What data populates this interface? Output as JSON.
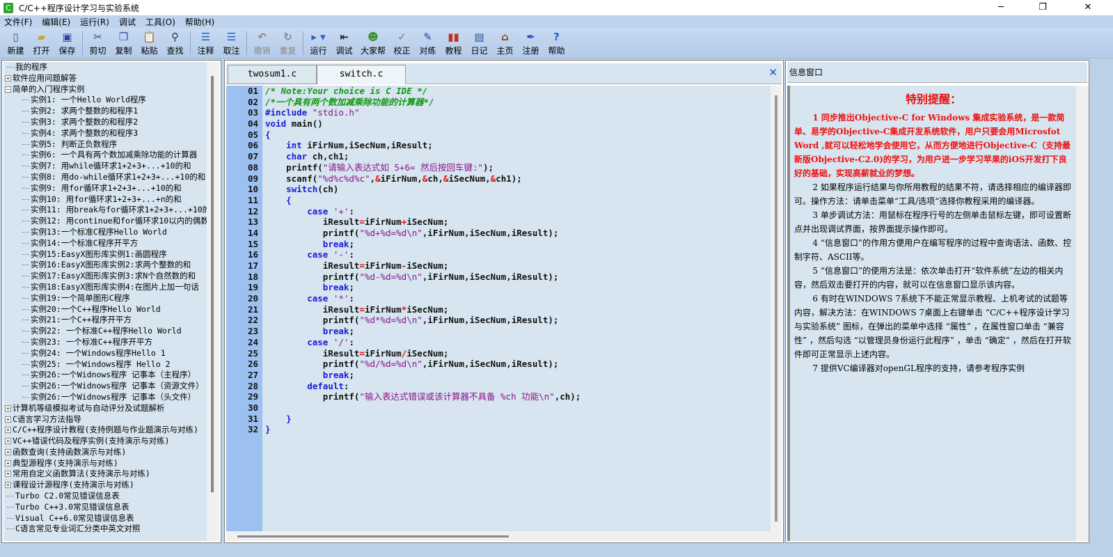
{
  "window": {
    "title": "C/C++程序设计学习与实验系统",
    "app_icon": "C",
    "minimize": "─",
    "maximize": "❐",
    "close": "✕"
  },
  "menu": [
    "文件(F)",
    "编辑(E)",
    "运行(R)",
    "调试",
    "工具(O)",
    "帮助(H)"
  ],
  "toolbar": [
    {
      "label": "新建",
      "icon": "new-file-icon",
      "glyph": "▯",
      "color": "#555",
      "disabled": false
    },
    {
      "label": "打开",
      "icon": "open-folder-icon",
      "glyph": "▰",
      "color": "#d8a020",
      "disabled": false
    },
    {
      "label": "保存",
      "icon": "save-disk-icon",
      "glyph": "▣",
      "color": "#3040a0",
      "disabled": false,
      "sep": true
    },
    {
      "label": "剪切",
      "icon": "scissors-icon",
      "glyph": "✂",
      "color": "#3050a0",
      "disabled": false
    },
    {
      "label": "复制",
      "icon": "copy-icon",
      "glyph": "❐",
      "color": "#3050a0",
      "disabled": false
    },
    {
      "label": "粘贴",
      "icon": "paste-icon",
      "glyph": "📋",
      "color": "#a07020",
      "disabled": false
    },
    {
      "label": "查找",
      "icon": "binoculars-icon",
      "glyph": "⚲",
      "color": "#333",
      "disabled": false,
      "sep": true
    },
    {
      "label": "注释",
      "icon": "comment-icon",
      "glyph": "☰",
      "color": "#2060c0",
      "disabled": false
    },
    {
      "label": "取注",
      "icon": "uncomment-icon",
      "glyph": "☰",
      "color": "#2060c0",
      "disabled": false,
      "sep": true
    },
    {
      "label": "撤销",
      "icon": "undo-icon",
      "glyph": "↶",
      "color": "#888",
      "disabled": true
    },
    {
      "label": "重复",
      "icon": "redo-icon",
      "glyph": "↻",
      "color": "#888",
      "disabled": true,
      "sep": true
    },
    {
      "label": "运行",
      "icon": "run-icon",
      "glyph": "▸ ▾",
      "color": "#2060d0",
      "disabled": false
    },
    {
      "label": "调试",
      "icon": "debug-icon",
      "glyph": "⇤",
      "color": "#223",
      "disabled": false
    },
    {
      "label": "大家帮",
      "icon": "people-icon",
      "glyph": "☻",
      "color": "#3a9030",
      "disabled": false
    },
    {
      "label": "校正",
      "icon": "check-icon",
      "glyph": "✓",
      "color": "#777",
      "disabled": false
    },
    {
      "label": "对练",
      "icon": "practice-icon",
      "glyph": "✎",
      "color": "#2040a0",
      "disabled": false
    },
    {
      "label": "教程",
      "icon": "books-icon",
      "glyph": "▮▮",
      "color": "#c03020",
      "disabled": false
    },
    {
      "label": "日记",
      "icon": "diary-icon",
      "glyph": "▤",
      "color": "#2050a0",
      "disabled": false
    },
    {
      "label": "主页",
      "icon": "home-icon",
      "glyph": "⌂",
      "color": "#805010",
      "disabled": false
    },
    {
      "label": "注册",
      "icon": "register-pen-icon",
      "glyph": "✒",
      "color": "#2040c0",
      "disabled": false
    },
    {
      "label": "帮助",
      "icon": "help-icon",
      "glyph": "?",
      "color": "#2060d0",
      "disabled": false
    }
  ],
  "tree": [
    {
      "label": "我的程序",
      "type": "leaf"
    },
    {
      "label": "软件应用问题解答",
      "type": "collapsed"
    },
    {
      "label": "简单的入门程序实例",
      "type": "expanded"
    },
    {
      "label": "实例1: 一个Hello World程序",
      "type": "child"
    },
    {
      "label": "实例2: 求两个整数的和程序1",
      "type": "child"
    },
    {
      "label": "实例3: 求两个整数的和程序2",
      "type": "child"
    },
    {
      "label": "实例4: 求两个整数的和程序3",
      "type": "child"
    },
    {
      "label": "实例5: 判断正负数程序",
      "type": "child"
    },
    {
      "label": "实例6: 一个具有两个数加减乘除功能的计算器",
      "type": "child"
    },
    {
      "label": "实例7: 用while循环求1+2+3+...+10的和",
      "type": "child"
    },
    {
      "label": "实例8: 用do-while循环求1+2+3+...+10的和",
      "type": "child"
    },
    {
      "label": "实例9: 用for循环求1+2+3+...+10的和",
      "type": "child"
    },
    {
      "label": "实例10: 用for循环求1+2+3+...+n的和",
      "type": "child"
    },
    {
      "label": "实例11: 用break与for循环求1+2+3+...+10的",
      "type": "child"
    },
    {
      "label": "实例12: 用continue和for循环求10以内的偶数",
      "type": "child"
    },
    {
      "label": "实例13:一个标准C程序Hello World",
      "type": "child"
    },
    {
      "label": "实例14:一个标准C程序开平方",
      "type": "child"
    },
    {
      "label": "实例15:EasyX图形库实例1:画圆程序",
      "type": "child"
    },
    {
      "label": "实例16:EasyX图形库实例2:求两个整数的和",
      "type": "child"
    },
    {
      "label": "实例17:EasyX图形库实例3:求N个自然数的和",
      "type": "child"
    },
    {
      "label": "实例18:EasyX图形库实例4:在图片上加一句话",
      "type": "child"
    },
    {
      "label": "实例19:一个简单图形C程序",
      "type": "child"
    },
    {
      "label": "实例20:一个C++程序Hello World",
      "type": "child"
    },
    {
      "label": "实例21:一个C++程序开平方",
      "type": "child"
    },
    {
      "label": "实例22: 一个标准C++程序Hello World",
      "type": "child"
    },
    {
      "label": "实例23: 一个标准C++程序开平方",
      "type": "child"
    },
    {
      "label": "实例24: 一个Windows程序Hello 1",
      "type": "child"
    },
    {
      "label": "实例25: 一个Windows程序 Hello 2",
      "type": "child"
    },
    {
      "label": "实例26:一个Widnows程序 记事本（主程序）",
      "type": "child"
    },
    {
      "label": "实例26:一个Widnows程序 记事本（资源文件）",
      "type": "child"
    },
    {
      "label": "实例26:一个Widnows程序 记事本（头文件）",
      "type": "child"
    },
    {
      "label": "计算机等级模拟考试与自动评分及试题解析",
      "type": "collapsed"
    },
    {
      "label": "C语言学习方法指导",
      "type": "collapsed"
    },
    {
      "label": "C/C++程序设计教程(支持例题与作业题演示与对练)",
      "type": "collapsed"
    },
    {
      "label": "VC++错误代码及程序实例(支持演示与对练)",
      "type": "collapsed"
    },
    {
      "label": "函数查询(支持函数演示与对练)",
      "type": "collapsed"
    },
    {
      "label": "典型源程序(支持演示与对练)",
      "type": "collapsed"
    },
    {
      "label": "常用自定义函数算法(支持演示与对练)",
      "type": "collapsed"
    },
    {
      "label": "课程设计源程序(支持演示与对练)",
      "type": "collapsed"
    },
    {
      "label": "Turbo C2.0常见错误信息表",
      "type": "leaf"
    },
    {
      "label": "Turbo C++3.0常见错误信息表",
      "type": "leaf"
    },
    {
      "label": "Visual C++6.0常见错误信息表",
      "type": "leaf"
    },
    {
      "label": "C语言常见专业词汇分类中英文对照",
      "type": "leaf"
    }
  ],
  "editor": {
    "tabs": [
      {
        "label": "twosum1.c",
        "active": false
      },
      {
        "label": "switch.c",
        "active": true
      }
    ],
    "close_glyph": "✕",
    "lines": [
      {
        "no": "01",
        "tokens": [
          [
            "c",
            "/* Note:Your choice is C IDE */"
          ]
        ]
      },
      {
        "no": "02",
        "tokens": [
          [
            "c",
            "/*一个具有两个数加减乘除功能的计算器*/"
          ]
        ]
      },
      {
        "no": "03",
        "tokens": [
          [
            "k",
            "#include"
          ],
          [
            "t",
            " "
          ],
          [
            "s",
            "\"stdio.h\""
          ]
        ]
      },
      {
        "no": "04",
        "tokens": [
          [
            "k",
            "void"
          ],
          [
            "t",
            " main()"
          ]
        ]
      },
      {
        "no": "05",
        "tokens": [
          [
            "k",
            "{"
          ]
        ]
      },
      {
        "no": "06",
        "tokens": [
          [
            "t",
            "    "
          ],
          [
            "k",
            "int"
          ],
          [
            "t",
            " iFirNum,iSecNum,iResult;"
          ]
        ]
      },
      {
        "no": "07",
        "tokens": [
          [
            "t",
            "    "
          ],
          [
            "k",
            "char"
          ],
          [
            "t",
            " ch,ch1;"
          ]
        ]
      },
      {
        "no": "08",
        "tokens": [
          [
            "t",
            "    printf("
          ],
          [
            "s",
            "\"请输入表达式如 5+6= 然后按回车键:\""
          ],
          [
            "t",
            ");"
          ]
        ]
      },
      {
        "no": "09",
        "tokens": [
          [
            "t",
            "    scanf("
          ],
          [
            "s",
            "\"%d%c%d%c\""
          ],
          [
            "t",
            ","
          ],
          [
            "o",
            "&"
          ],
          [
            "t",
            "iFirNum,"
          ],
          [
            "o",
            "&"
          ],
          [
            "t",
            "ch,"
          ],
          [
            "o",
            "&"
          ],
          [
            "t",
            "iSecNum,"
          ],
          [
            "o",
            "&"
          ],
          [
            "t",
            "ch1);"
          ]
        ]
      },
      {
        "no": "10",
        "tokens": [
          [
            "t",
            "    "
          ],
          [
            "k",
            "switch"
          ],
          [
            "t",
            "(ch)"
          ]
        ]
      },
      {
        "no": "11",
        "tokens": [
          [
            "t",
            "    "
          ],
          [
            "k",
            "{"
          ]
        ]
      },
      {
        "no": "12",
        "tokens": [
          [
            "t",
            "        "
          ],
          [
            "k",
            "case"
          ],
          [
            "t",
            " "
          ],
          [
            "s",
            "'+'"
          ],
          [
            "t",
            ":"
          ]
        ]
      },
      {
        "no": "13",
        "tokens": [
          [
            "t",
            "           iResult"
          ],
          [
            "o",
            "="
          ],
          [
            "t",
            "iFirNum"
          ],
          [
            "o",
            "+"
          ],
          [
            "t",
            "iSecNum;"
          ]
        ]
      },
      {
        "no": "14",
        "tokens": [
          [
            "t",
            "           printf("
          ],
          [
            "s",
            "\"%d+%d=%d\\n\""
          ],
          [
            "t",
            ",iFirNum,iSecNum,iResult);"
          ]
        ]
      },
      {
        "no": "15",
        "tokens": [
          [
            "t",
            "           "
          ],
          [
            "k",
            "break"
          ],
          [
            "t",
            ";"
          ]
        ]
      },
      {
        "no": "16",
        "tokens": [
          [
            "t",
            "        "
          ],
          [
            "k",
            "case"
          ],
          [
            "t",
            " "
          ],
          [
            "s",
            "'-'"
          ],
          [
            "t",
            ":"
          ]
        ]
      },
      {
        "no": "17",
        "tokens": [
          [
            "t",
            "           iResult"
          ],
          [
            "o",
            "="
          ],
          [
            "t",
            "iFirNum"
          ],
          [
            "o",
            "-"
          ],
          [
            "t",
            "iSecNum;"
          ]
        ]
      },
      {
        "no": "18",
        "tokens": [
          [
            "t",
            "           printf("
          ],
          [
            "s",
            "\"%d-%d=%d\\n\""
          ],
          [
            "t",
            ",iFirNum,iSecNum,iResult);"
          ]
        ]
      },
      {
        "no": "19",
        "tokens": [
          [
            "t",
            "           "
          ],
          [
            "k",
            "break"
          ],
          [
            "t",
            ";"
          ]
        ]
      },
      {
        "no": "20",
        "tokens": [
          [
            "t",
            "        "
          ],
          [
            "k",
            "case"
          ],
          [
            "t",
            " "
          ],
          [
            "s",
            "'*'"
          ],
          [
            "t",
            ":"
          ]
        ]
      },
      {
        "no": "21",
        "tokens": [
          [
            "t",
            "           iResult"
          ],
          [
            "o",
            "="
          ],
          [
            "t",
            "iFirNum"
          ],
          [
            "o",
            "*"
          ],
          [
            "t",
            "iSecNum;"
          ]
        ]
      },
      {
        "no": "22",
        "tokens": [
          [
            "t",
            "           printf("
          ],
          [
            "s",
            "\"%d*%d=%d\\n\""
          ],
          [
            "t",
            ",iFirNum,iSecNum,iResult);"
          ]
        ]
      },
      {
        "no": "23",
        "tokens": [
          [
            "t",
            "           "
          ],
          [
            "k",
            "break"
          ],
          [
            "t",
            ";"
          ]
        ]
      },
      {
        "no": "24",
        "tokens": [
          [
            "t",
            "        "
          ],
          [
            "k",
            "case"
          ],
          [
            "t",
            " "
          ],
          [
            "s",
            "'/'"
          ],
          [
            "t",
            ":"
          ]
        ]
      },
      {
        "no": "25",
        "tokens": [
          [
            "t",
            "           iResult"
          ],
          [
            "o",
            "="
          ],
          [
            "t",
            "iFirNum"
          ],
          [
            "o",
            "/"
          ],
          [
            "t",
            "iSecNum;"
          ]
        ]
      },
      {
        "no": "26",
        "tokens": [
          [
            "t",
            "           printf("
          ],
          [
            "s",
            "\"%d/%d=%d\\n\""
          ],
          [
            "t",
            ",iFirNum,iSecNum,iResult);"
          ]
        ]
      },
      {
        "no": "27",
        "tokens": [
          [
            "t",
            "           "
          ],
          [
            "k",
            "break"
          ],
          [
            "t",
            ";"
          ]
        ]
      },
      {
        "no": "28",
        "tokens": [
          [
            "t",
            "        "
          ],
          [
            "k",
            "default"
          ],
          [
            "t",
            ":"
          ]
        ]
      },
      {
        "no": "29",
        "tokens": [
          [
            "t",
            "           printf("
          ],
          [
            "s",
            "\"输入表达式错误或该计算器不具备 %ch 功能\\n\""
          ],
          [
            "t",
            ",ch);"
          ]
        ]
      },
      {
        "no": "30",
        "tokens": []
      },
      {
        "no": "31",
        "tokens": [
          [
            "t",
            "    "
          ],
          [
            "k",
            "}"
          ]
        ]
      },
      {
        "no": "32",
        "tokens": [
          [
            "k",
            "}"
          ]
        ]
      }
    ]
  },
  "info": {
    "title": "信息窗口",
    "heading": "特别提醒：",
    "paragraphs": [
      {
        "text": "1  同步推出Objective-C for Windows 集成实验系统，是一款简单、易学的Objective-C集成开发系统软件，用户只要会用Microsfot Word ,就可以轻松地学会使用它，从而方便地进行Objective-C（支持最新版Objective-C2.0)的学习，为用户进一步学习苹果的iOS开发打下良好的基础，实现高薪就业的梦想。",
        "red": true
      },
      {
        "text": "2  如果程序运行结果与你所用教程的结果不符，请选择相应的编译器即可。操作方法：请单击菜单“工具/选项“选择你教程采用的编译器。",
        "red": false
      },
      {
        "text": "3  单步调试方法：用鼠标在程序行号的左侧单击鼠标左键，即可设置断点并出现调试界面，按界面提示操作即可。",
        "red": false
      },
      {
        "text": "4 “信息窗口”的作用方便用户在编写程序的过程中查询语法、函数、控制字符、ASCII等。",
        "red": false
      },
      {
        "text": "5 “信息窗口”的使用方法是：依次单击打开“软件系统”左边的相关内容，然后双击要打开的内容，就可以在信息窗口显示该内容。",
        "red": false
      },
      {
        "text": "6  有时在WINDOWS 7系统下不能正常显示教程、上机考试的试题等内容，解决方法：在WINDOWS 7桌面上右键单击 “C/C++程序设计学习与实验系统” 图标，在弹出的菜单中选择 “属性” ，在属性窗口单击 “兼容性” ，然后勾选 “以管理员身份运行此程序” ，单击 “确定” ，然后在打开软件即可正常显示上述内容。",
        "red": false
      },
      {
        "text": "7  提供VC编译器对openGL程序的支持，请参考程序实例",
        "red": false
      }
    ]
  }
}
